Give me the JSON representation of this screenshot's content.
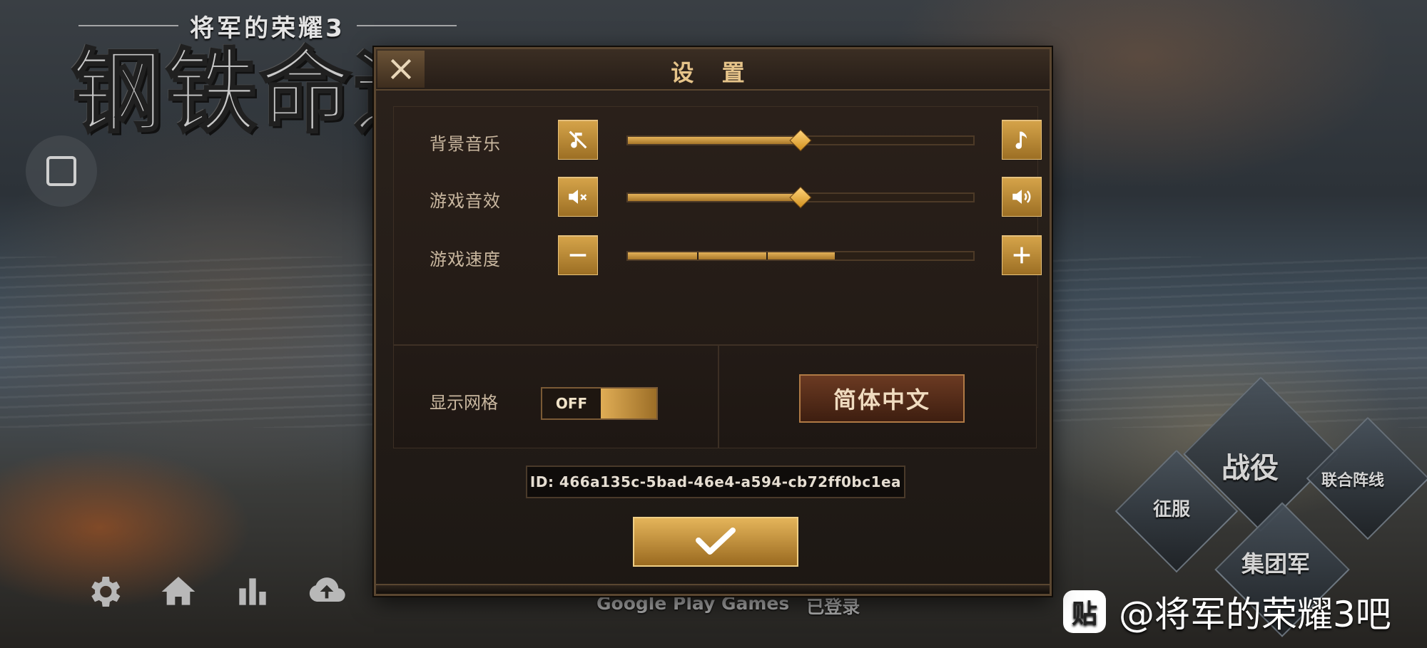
{
  "background": {
    "logo_subtitle": "将军的荣耀3",
    "logo_title": "钢铁命运",
    "status_left": "Google Play Games",
    "status_right": "已登录",
    "watermark_icon": "贴",
    "watermark_text": "@将军的荣耀3吧",
    "bottom_icons": [
      "settings-icon",
      "home-icon",
      "stats-icon",
      "cloud-upload-icon"
    ],
    "modes": {
      "campaign": "战役",
      "conquest": "征服",
      "allied_front": "联合阵线",
      "army_group": "集团军"
    }
  },
  "dialog": {
    "title": "设 置",
    "close_icon": "close-icon",
    "rows": [
      {
        "label": "背景音乐",
        "left_icon": "music-mute-icon",
        "right_icon": "music-note-icon",
        "value_fraction": 0.5
      },
      {
        "label": "游戏音效",
        "left_icon": "speaker-mute-icon",
        "right_icon": "speaker-loud-icon",
        "value_fraction": 0.5
      },
      {
        "label": "游戏速度",
        "left_icon": "minus-icon",
        "right_icon": "plus-icon",
        "value_fraction": 0.6,
        "segments": 5
      }
    ],
    "grid": {
      "label": "显示网格",
      "state": "OFF"
    },
    "language_button": "简体中文",
    "id_text": "ID: 466a135c-5bad-46e4-a594-cb72ff0bc1ea",
    "confirm_icon": "checkmark-icon"
  },
  "colors": {
    "accent_gold": "#d6a44a",
    "title_gold": "#e6c48a",
    "dialog_bg": "#231b16"
  }
}
